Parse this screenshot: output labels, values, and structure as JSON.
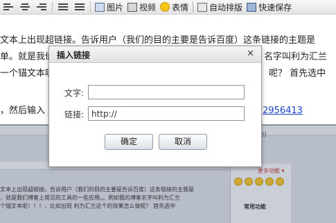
{
  "toolbar": {
    "image_label": "图片",
    "video_label": "视频",
    "emoji_label": "表情",
    "autoformat_label": "自动排版",
    "quicksave_label": "快速保存"
  },
  "editor": {
    "line1": "文本上出现超链接。告诉用户（我们的目的主要是告诉百度）这条链接的主题是",
    "line2a": "单。就是我们",
    "line2b": "名字叫利为汇兰",
    "line3a": "一个锚文本呢",
    "line3b": "呢？ 首先选中",
    "line4a": "，然后输入",
    "line4_link": "2956413"
  },
  "dialog": {
    "title": "插入链接",
    "close_symbol": "×",
    "text_label": "文字:",
    "text_value": "",
    "link_label": "链接:",
    "link_value": "http://",
    "ok_label": "确定",
    "cancel_label": "取消"
  },
  "background_screenshot": {
    "help_label": "[帮助]",
    "more_label": "更多功能 ▾",
    "common_functions": "常用功能",
    "text_line1": "文本上出现超链接。告诉用户（我们的目的主要是告诉百度）这条链接的主题是",
    "text_line2": "，就是我们博客上常见的工具的一些应用。。例如我的博客名字叫利为汇兰",
    "text_line3": "个锚文本呢！！！，比如出现 利为汇兰这个的效果怎么做呢？ 首先选中"
  }
}
